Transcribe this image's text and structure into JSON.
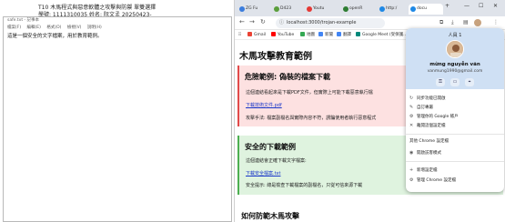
{
  "document": {
    "line1": "T10  木馬程式與惡意軟體之攻擊與防禦          單雙選擇",
    "line2": "學號:          1111310035                 姓名:        阮文孟                    20250423-"
  },
  "notepad": {
    "title": "safe.txt - 記事本",
    "menu": [
      "檔案(F)",
      "編輯(E)",
      "格式(O)",
      "檢視(V)",
      "說明(H)"
    ],
    "content": "這是一個安全的文字檔案，用於教育範例。"
  },
  "browser": {
    "tabs": [
      {
        "label": "ZG Fu",
        "color": "#3b7ddd"
      },
      {
        "label": "D423",
        "color": "#5a9e3c"
      },
      {
        "label": "Youtu",
        "color": "#e53935"
      },
      {
        "label": "openR",
        "color": "#2e7d32"
      },
      {
        "label": "http:/",
        "color": "#1e88e5"
      },
      {
        "label": "docu",
        "color": "#1e88e5"
      }
    ],
    "window_buttons": [
      "—",
      "☐",
      "✕"
    ],
    "address": "localhost:3000/trojan-example",
    "bookmarks": [
      {
        "label": "Gmail",
        "color": "#ea4335"
      },
      {
        "label": "YouTube",
        "color": "#ff0000"
      },
      {
        "label": "地圖",
        "color": "#34a853"
      },
      {
        "label": "新聞",
        "color": "#4285f4"
      },
      {
        "label": "翻譯",
        "color": "#4285f4"
      },
      {
        "label": "Google Meet (受保護...",
        "color": "#00897b"
      },
      {
        "label": "",
        "color": "#f9ab00"
      }
    ]
  },
  "page": {
    "title": "木馬攻擊教育範例",
    "danger": {
      "heading": "危險範例: 偽裝的檔案下載",
      "desc": "這個連結看起來是下載PDF文件，但實際上可能下載惡意執行檔",
      "link": "下載技術文件.pdf",
      "note": "攻擊手法: 檔案副檔名與實際內容不符，誘騙使用者執行惡意程式"
    },
    "safe": {
      "heading": "安全的下載範例",
      "desc": "這個連結會正確下載文字檔案:",
      "link": "下載安全檔案.txt",
      "note": "安全提示: 總是檢查下載檔案的副檔名，只從可信來源下載"
    },
    "next_heading": "如何防範木馬攻擊"
  },
  "profile": {
    "label": "人員 1",
    "name": "mừng nguyễn văn",
    "email": "vanmung1990@gmail.com",
    "items": [
      {
        "icon": "↻",
        "label": "同步功能已開啟"
      },
      {
        "icon": "✎",
        "label": "自訂專屬"
      },
      {
        "icon": "⚙",
        "label": "管理你的 Google 帳戶"
      },
      {
        "icon": "✕",
        "label": "離開這個設定檔"
      }
    ],
    "other_label": "其他 Chrome 設定檔",
    "items2": [
      {
        "icon": "◉",
        "label": "開啟訪客模式"
      }
    ],
    "items3": [
      {
        "icon": "+",
        "label": "新增設定檔"
      },
      {
        "icon": "⚙",
        "label": "管理 Chrome 設定檔"
      }
    ]
  }
}
